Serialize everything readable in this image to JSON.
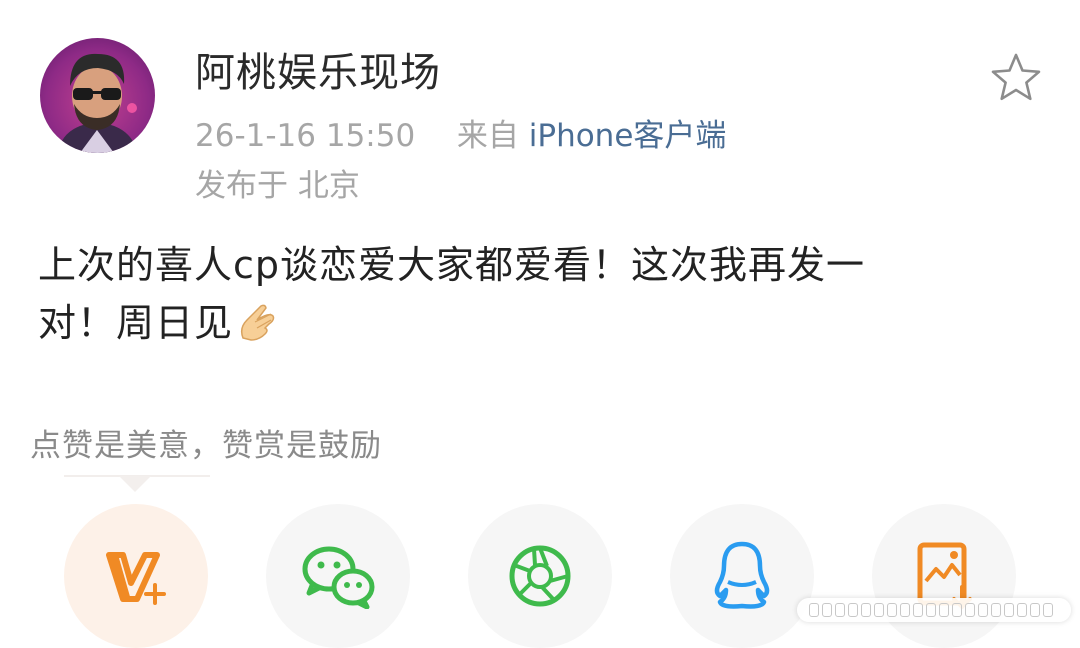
{
  "post": {
    "author_name": "阿桃娱乐现场",
    "timestamp": "26-1-16 15:50",
    "source_prefix": "来自",
    "source_client": "iPhone客户端",
    "location_prefix": "发布于",
    "location": "北京",
    "body_line1": "上次的喜人cp谈恋爱大家都爱看！这次我再发一",
    "body_line2": "对！周日见"
  },
  "reward": {
    "note": "点赞是美意，赞赏是鼓励"
  },
  "share_options": [
    {
      "icon": "vip-reward-icon"
    },
    {
      "icon": "wechat-icon"
    },
    {
      "icon": "moments-icon"
    },
    {
      "icon": "qq-icon"
    },
    {
      "icon": "save-image-icon"
    }
  ],
  "colors": {
    "accent_orange": "#f08a24",
    "wechat_green": "#3fba4c",
    "qq_blue": "#2a9cf0",
    "link_blue": "#4a6d94"
  }
}
